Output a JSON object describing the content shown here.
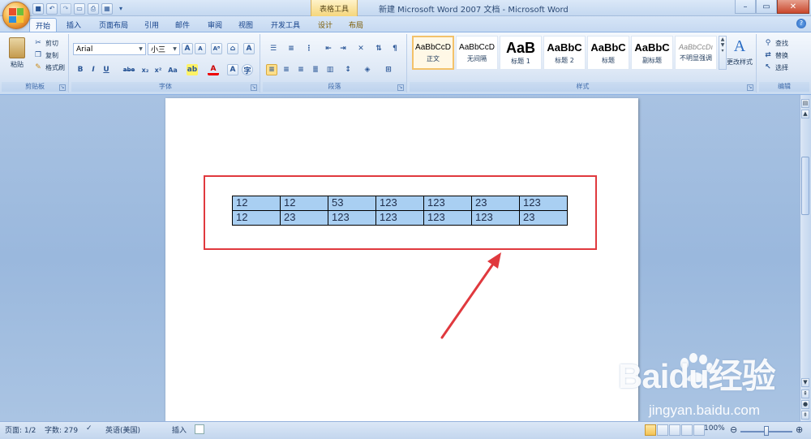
{
  "title_bar": {
    "context_tool": "表格工具",
    "doc_title": "新建 Microsoft Word 2007 文档 - Microsoft Word",
    "qat_icons": [
      "save-icon",
      "undo-icon",
      "redo-icon",
      "new-doc-icon",
      "print-preview-icon",
      "chart-icon",
      "customize-icon"
    ]
  },
  "tabs": [
    {
      "label": "开始"
    },
    {
      "label": "插入"
    },
    {
      "label": "页面布局"
    },
    {
      "label": "引用"
    },
    {
      "label": "邮件"
    },
    {
      "label": "审阅"
    },
    {
      "label": "视图"
    },
    {
      "label": "开发工具"
    },
    {
      "label": "设计"
    },
    {
      "label": "布局"
    }
  ],
  "clipboard": {
    "paste": "粘贴",
    "cut": "剪切",
    "copy": "复制",
    "format_painter": "格式刷",
    "group_label": "剪贴板"
  },
  "font": {
    "family": "Arial",
    "size": "小三",
    "group_label": "字体",
    "buttons": [
      "B",
      "I",
      "U",
      "abe",
      "x₂",
      "x²",
      "Aa"
    ]
  },
  "paragraph": {
    "group_label": "段落"
  },
  "styles": {
    "group_label": "样式",
    "tiles": [
      {
        "sample": "AaBbCcD",
        "name": "正文"
      },
      {
        "sample": "AaBbCcD",
        "name": "无间隔"
      },
      {
        "sample": "AaB",
        "name": "标题 1"
      },
      {
        "sample": "AaBbC",
        "name": "标题 2"
      },
      {
        "sample": "AaBbC",
        "name": "标题"
      },
      {
        "sample": "AaBbC",
        "name": "副标题"
      },
      {
        "sample": "AaBbCcDı",
        "name": "不明显强调"
      }
    ],
    "change_styles": "更改样式"
  },
  "editing": {
    "find": "查找",
    "replace": "替换",
    "select": "选择",
    "group_label": "编辑"
  },
  "table": {
    "rows": [
      [
        "12",
        "12",
        "53",
        "123",
        "123",
        "23",
        "123"
      ],
      [
        "12",
        "23",
        "123",
        "123",
        "123",
        "123",
        "23"
      ]
    ]
  },
  "watermark": {
    "brand": "Baidu经验",
    "url": "jingyan.baidu.com"
  },
  "status_bar": {
    "page": "页面: 1/2",
    "words": "字数: 279",
    "language": "英语(美国)",
    "insert_mode": "插入",
    "zoom": "100%"
  }
}
